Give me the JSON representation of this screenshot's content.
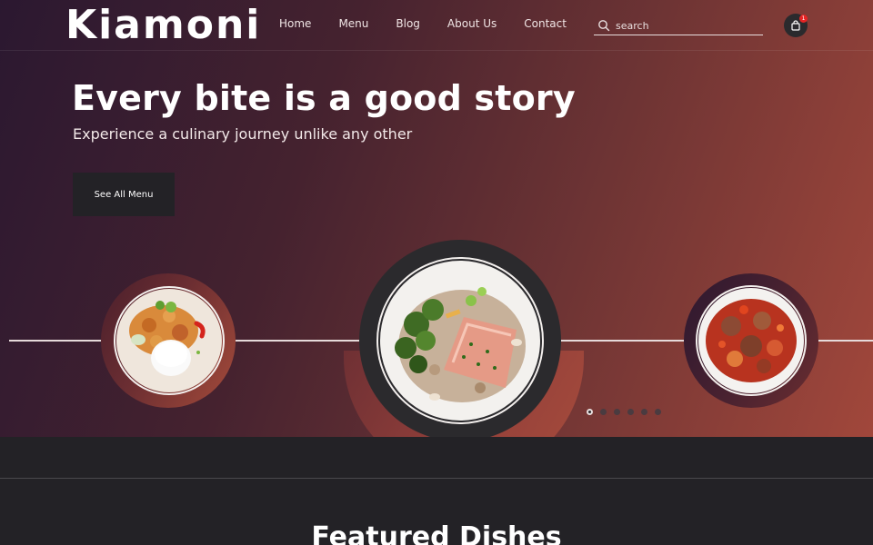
{
  "brand": {
    "name": "Kiamoni"
  },
  "nav": {
    "items": [
      {
        "label": "Home"
      },
      {
        "label": "Menu"
      },
      {
        "label": "Blog"
      },
      {
        "label": "About Us"
      },
      {
        "label": "Contact"
      }
    ],
    "search": {
      "placeholder": "search",
      "value": ""
    },
    "cart": {
      "count": "1"
    }
  },
  "hero": {
    "title": "Every bite is a good story",
    "subtitle": "Experience a culinary journey unlike any other",
    "cta_label": "See All Menu"
  },
  "carousel": {
    "active_index": 0,
    "dot_count": 6,
    "dishes": [
      {
        "icon": "rice-and-curry-dish"
      },
      {
        "icon": "salmon-with-broccoli-dish"
      },
      {
        "icon": "tomato-stew-dish"
      }
    ]
  },
  "featured": {
    "title": "Featured Dishes"
  },
  "colors": {
    "accent": "#a1473b",
    "dark": "#232226",
    "hero_start": "#2b1830",
    "badge": "#e52525"
  }
}
